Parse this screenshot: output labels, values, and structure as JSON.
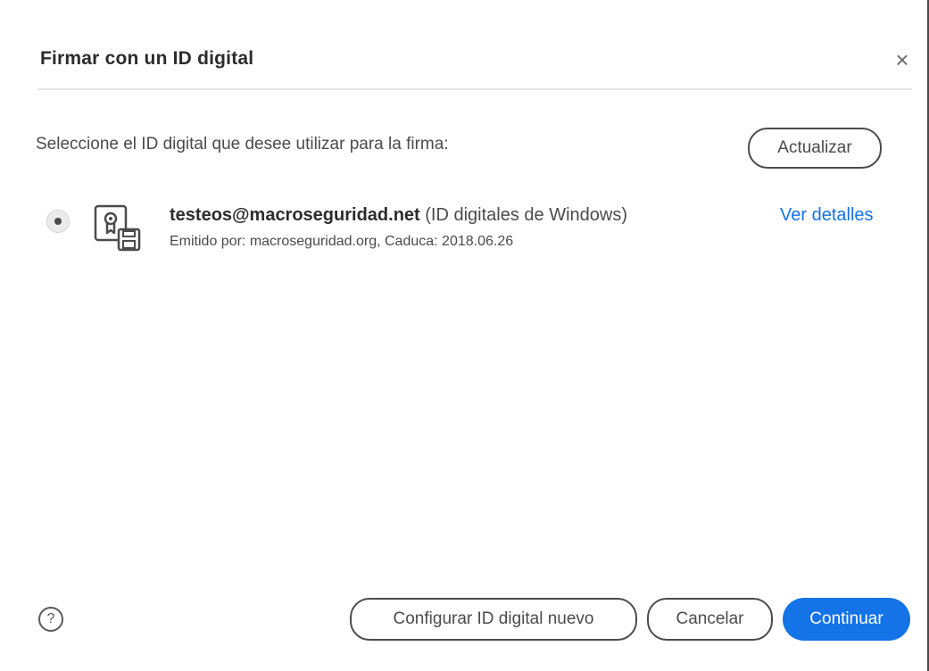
{
  "dialog": {
    "title": "Firmar con un ID digital",
    "close_label": "×"
  },
  "instruction": "Seleccione el ID digital que desee utilizar para la firma:",
  "refresh_label": "Actualizar",
  "digital_ids": [
    {
      "selected": true,
      "icon": "certificate-icon",
      "email": "testeos@macroseguridad.net",
      "type": "(ID digitales de Windows)",
      "details": "Emitido por: macroseguridad.org, Caduca: 2018.06.26",
      "details_link": "Ver detalles"
    }
  ],
  "footer": {
    "help_label": "?",
    "configure_label": "Configurar ID digital nuevo",
    "cancel_label": "Cancelar",
    "continue_label": "Continuar"
  },
  "colors": {
    "accent": "#1473e6",
    "text": "#2c2c2c",
    "secondary_text": "#4b4b4b"
  }
}
